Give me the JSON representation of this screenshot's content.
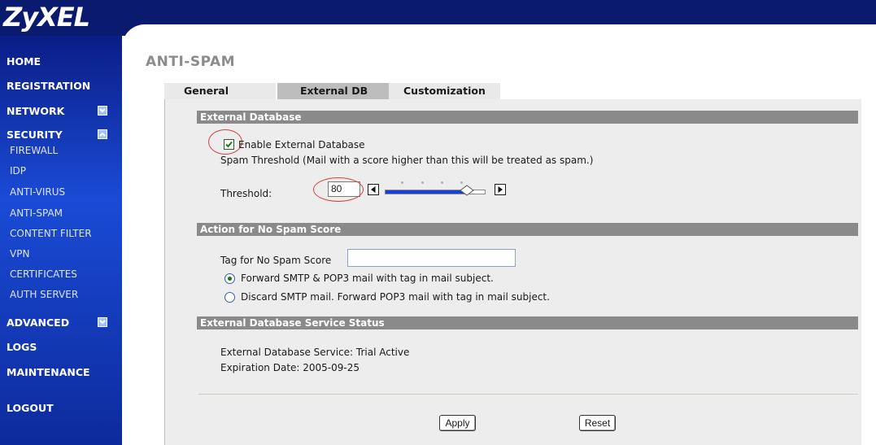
{
  "app": {
    "logo": "ZyXEL"
  },
  "sidebar": {
    "items": [
      {
        "label": "HOME"
      },
      {
        "label": "REGISTRATION"
      },
      {
        "label": "NETWORK",
        "toggle": "expand"
      },
      {
        "label": "SECURITY",
        "toggle": "collapse",
        "children": [
          "FIREWALL",
          "IDP",
          "ANTI-VIRUS",
          "ANTI-SPAM",
          "CONTENT FILTER",
          "VPN",
          "CERTIFICATES",
          "AUTH SERVER"
        ]
      },
      {
        "label": "ADVANCED",
        "toggle": "expand"
      },
      {
        "label": "LOGS"
      },
      {
        "label": "MAINTENANCE"
      },
      {
        "label": "LOGOUT"
      }
    ]
  },
  "page": {
    "title": "ANTI-SPAM"
  },
  "tabs": [
    {
      "label": "General",
      "active": false
    },
    {
      "label": "External DB",
      "active": true
    },
    {
      "label": "Customization",
      "active": false
    }
  ],
  "external_db": {
    "section_title": "External Database",
    "enable_label": "Enable External Database",
    "enable_checked": true,
    "threshold_desc": "Spam Threshold (Mail with a score higher than this will be treated as spam.)",
    "threshold_label": "Threshold:",
    "threshold_value": "80",
    "slider_level": 0.8
  },
  "no_spam": {
    "section_title": "Action for No Spam Score",
    "tag_label": "Tag for No Spam Score",
    "tag_value": "",
    "options": [
      {
        "label": "Forward SMTP & POP3 mail with tag in mail subject.",
        "selected": true
      },
      {
        "label": "Discard SMTP mail. Forward POP3 mail with tag in mail subject.",
        "selected": false
      }
    ]
  },
  "status": {
    "section_title": "External Database Service Status",
    "service_line": "External Database Service: Trial Active",
    "expiration_line": "Expiration Date: 2005-09-25"
  },
  "buttons": {
    "apply": "Apply",
    "reset": "Reset"
  },
  "colors": {
    "header": "#0a1a6e",
    "sidebar": "#1a4bd6",
    "section_bar": "#8a8a8a",
    "annotation": "#d94040",
    "slider": "#1a3fd8"
  },
  "icons": {
    "toggle_expand": "chevron-down-icon",
    "toggle_collapse": "chevron-up-icon",
    "slider_left": "arrow-left-icon",
    "slider_right": "arrow-right-icon",
    "slider_knob": "diamond-icon"
  }
}
